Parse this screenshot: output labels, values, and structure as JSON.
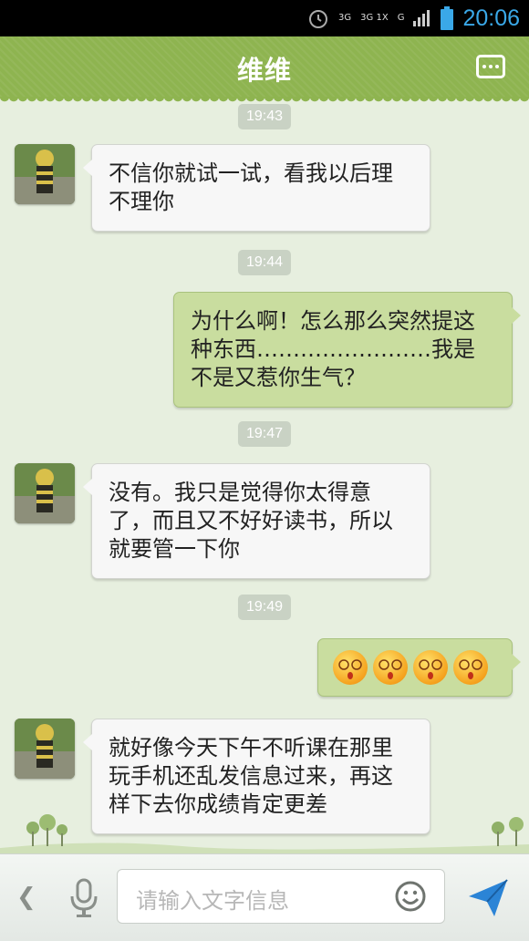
{
  "status": {
    "time": "20:06",
    "net1": "3G",
    "net2": "3G 1X",
    "net3": "G"
  },
  "header": {
    "title": "维维"
  },
  "messages": [
    {
      "type": "time",
      "text": "19:43"
    },
    {
      "type": "in",
      "text": "不信你就试一试，看我以后理不理你"
    },
    {
      "type": "time",
      "text": "19:44"
    },
    {
      "type": "out",
      "text": "为什么啊！怎么那么突然提这种东西……………………我是不是又惹你生气？"
    },
    {
      "type": "time",
      "text": "19:47"
    },
    {
      "type": "in",
      "text": "没有。我只是觉得你太得意了，而且又不好好读书，所以就要管一下你"
    },
    {
      "type": "time",
      "text": "19:49"
    },
    {
      "type": "out-emoji",
      "emoji": "dizzy-face-icon",
      "count": 4
    },
    {
      "type": "in",
      "text": "就好像今天下午不听课在那里玩手机还乱发信息过来，再这样下去你成绩肯定更差"
    }
  ],
  "input": {
    "placeholder": "请输入文字信息"
  },
  "colors": {
    "header": "#8eb450",
    "out_bubble": "#c9dd9f",
    "in_bubble": "#f7f7f7",
    "background": "#e7efdf"
  }
}
